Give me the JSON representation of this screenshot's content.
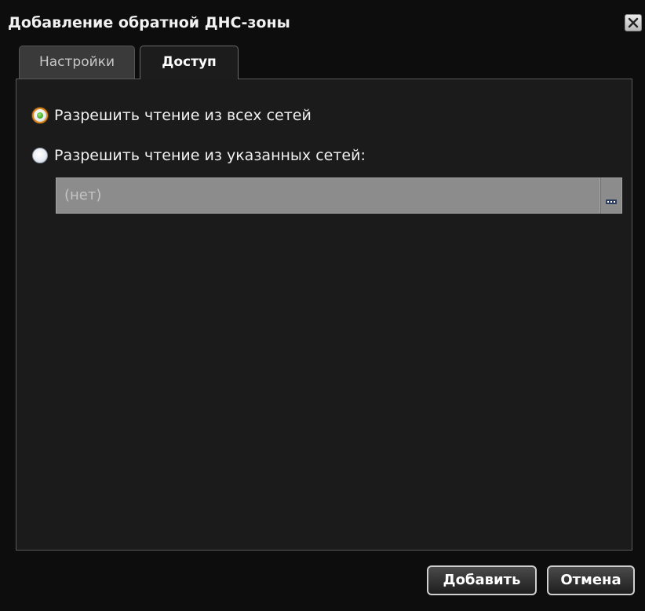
{
  "window": {
    "title": "Добавление обратной ДНС-зоны",
    "close_icon": "close-icon"
  },
  "tabs": [
    {
      "label": "Настройки",
      "active": false
    },
    {
      "label": "Доступ",
      "active": true
    }
  ],
  "access": {
    "options": [
      {
        "label": "Разрешить чтение из всех сетей",
        "checked": true
      },
      {
        "label": "Разрешить чтение из указанных сетей:",
        "checked": false
      }
    ],
    "networks_field": {
      "value": "(нет)",
      "browse_icon": "ellipsis-icon"
    }
  },
  "footer": {
    "add_label": "Добавить",
    "cancel_label": "Отмена"
  },
  "colors": {
    "background": "#0d0d0d",
    "panel": "#1b1b1b",
    "accent_checked": "#e08a1e",
    "radio_dot": "#3fa520",
    "field_disabled": "#8c8c8c"
  }
}
